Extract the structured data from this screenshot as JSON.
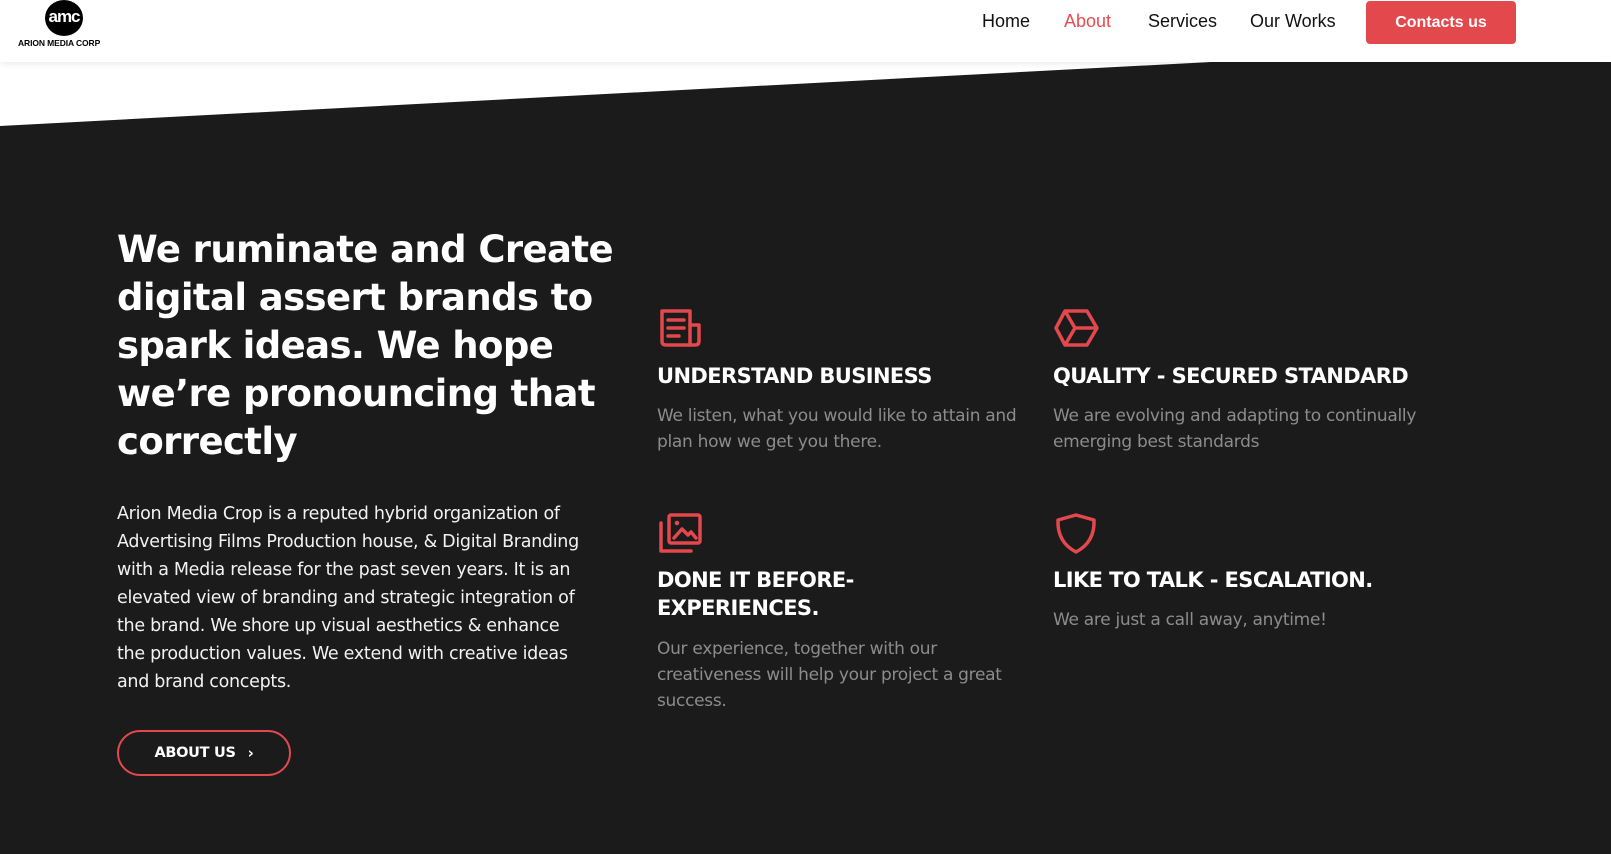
{
  "header": {
    "logo": {
      "mark": "amc",
      "name": "ARION MEDIA CORP"
    },
    "nav": [
      {
        "label": "Home",
        "active": false
      },
      {
        "label": "About",
        "active": true
      },
      {
        "label": "Services",
        "active": false
      },
      {
        "label": "Our Works",
        "active": false
      }
    ],
    "cta_label": "Contacts us"
  },
  "hero": {
    "headline": "We ruminate and Create digital assert brands to spark ideas. We hope we’re pronouncing that correctly",
    "intro": "Arion Media Crop is a reputed hybrid organization of Advertising Films Production house, & Digital Branding with a Media release for the past seven years. It is an elevated view of branding and strategic integration of the brand. We shore up visual aesthetics & enhance the production values. We extend with creative ideas and brand concepts.",
    "button_label": "ABOUT US"
  },
  "features": [
    {
      "icon": "newspaper-icon",
      "title": "UNDERSTAND BUSINESS",
      "text": "We listen, what you would like to attain and plan how we get you there."
    },
    {
      "icon": "cube-icon",
      "title": "QUALITY - SECURED STANDARD",
      "text": "We are evolving and adapting to continually emerging best standards"
    },
    {
      "icon": "images-icon",
      "title": "DONE IT BEFORE- EXPERIENCES.",
      "text": "Our experience, together with our creativeness will help your project a great success."
    },
    {
      "icon": "shield-icon",
      "title": "LIKE TO TALK - ESCALATION.",
      "text": "We are just a call away, anytime!"
    }
  ],
  "colors": {
    "accent": "#e2484c",
    "background": "#1b1b1c",
    "muted_text": "#8c8c8c"
  }
}
